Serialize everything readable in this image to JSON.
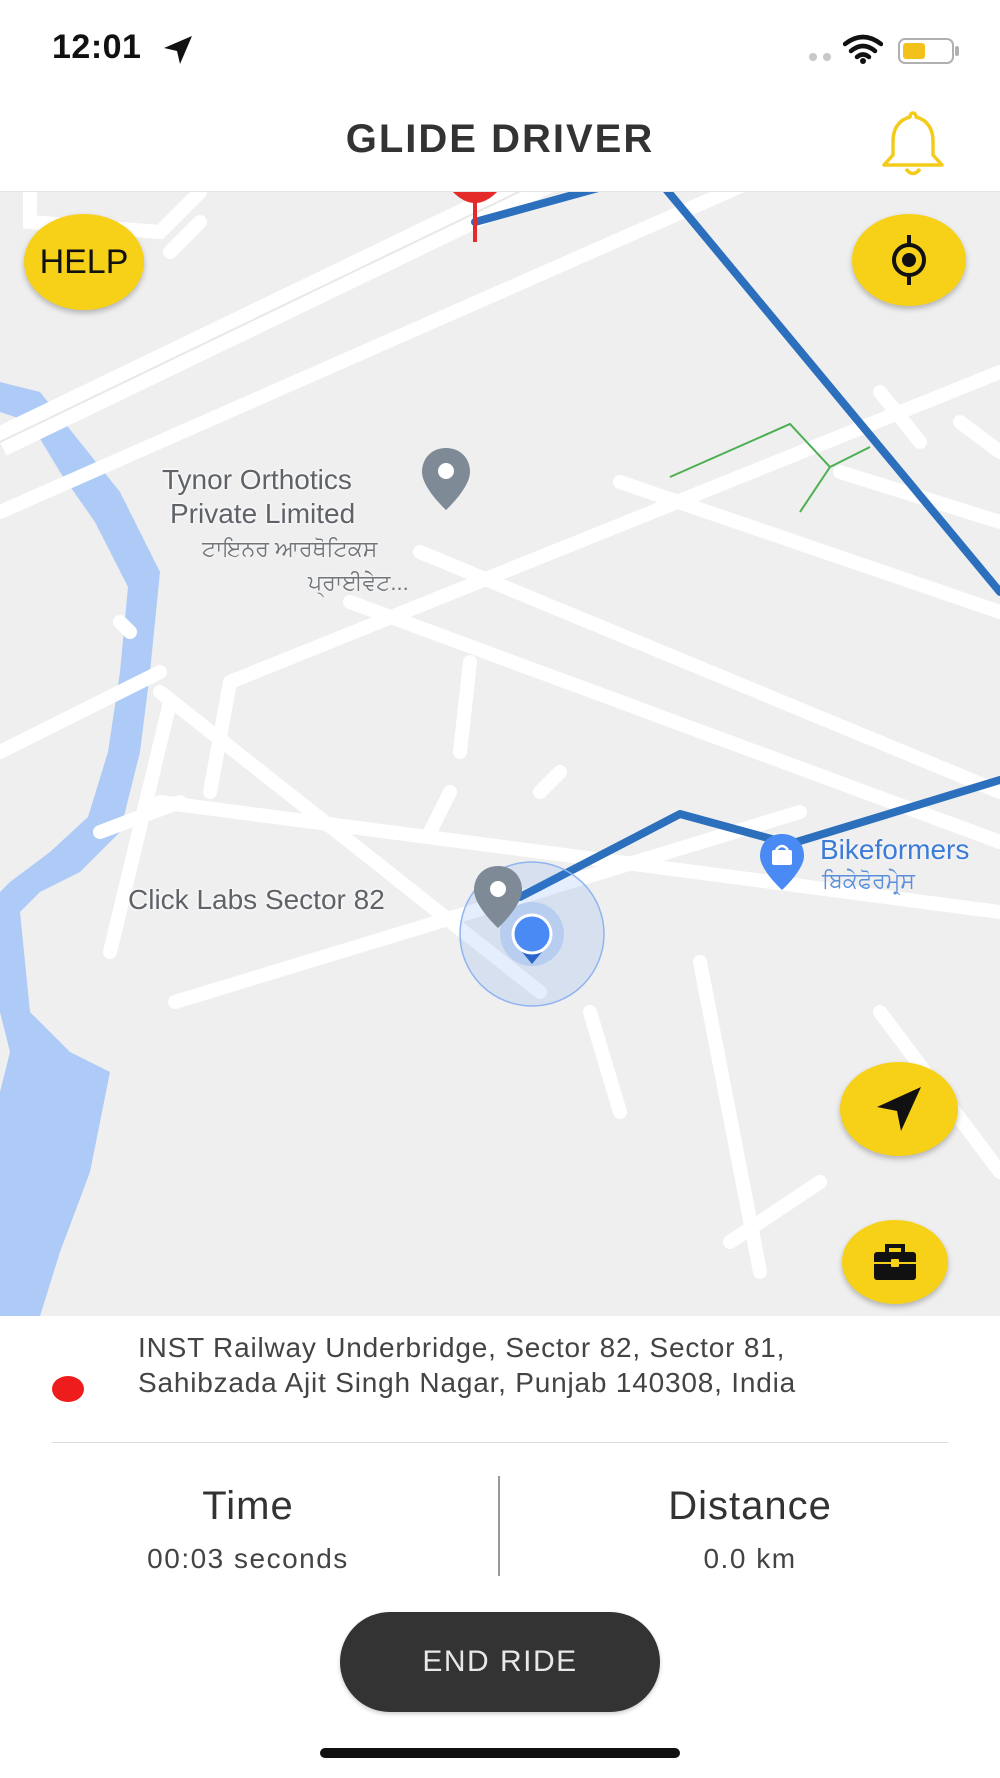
{
  "status_bar": {
    "time": "12:01"
  },
  "header": {
    "title": "GLIDE DRIVER"
  },
  "map": {
    "help_label": "HELP",
    "pois": {
      "tynor_line1": "Tynor Orthotics",
      "tynor_line2": "Private Limited",
      "tynor_sub1": "ਟਾਇਨਰ ਆਰਥੋਟਿਕਸ",
      "tynor_sub2": "ਪ੍ਰਾਈਵੇਟ...",
      "clicklabs": "Click Labs Sector 82",
      "bikeformers": "Bikeformers",
      "bikeformers_sub": "ਬਿਕੇਫੋਰਮੇਰ੍ਸ"
    },
    "colors": {
      "route": "#2b6fbd",
      "water": "#a9c8f5",
      "button": "#f7d117"
    }
  },
  "destination": {
    "address": "INST Railway Underbridge, Sector 82, Sector 81, Sahibzada Ajit Singh Nagar, Punjab 140308, India"
  },
  "trip": {
    "time_label": "Time",
    "time_value": "00:03 seconds",
    "distance_label": "Distance",
    "distance_value": "0.0 km"
  },
  "actions": {
    "end_ride_label": "END RIDE"
  }
}
